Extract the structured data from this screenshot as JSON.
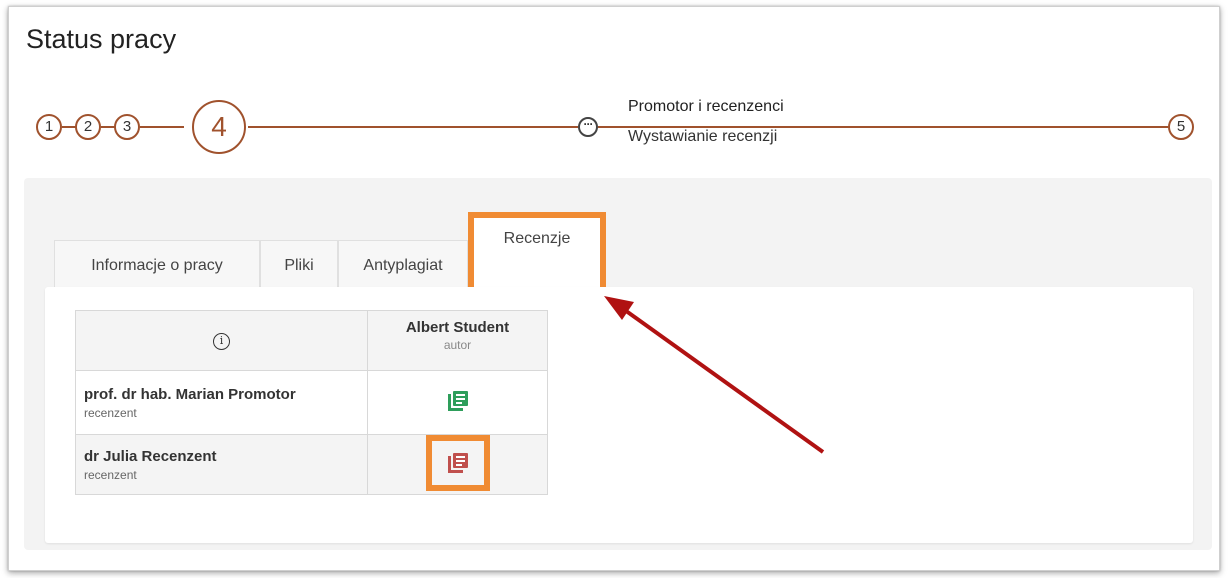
{
  "page": {
    "title": "Status pracy"
  },
  "stepper": {
    "steps": [
      "1",
      "2",
      "3",
      "4",
      "5"
    ],
    "current_step": "4",
    "current_caption": "Promotor i recenzenci",
    "current_subcaption": "Wystawianie recenzji"
  },
  "tabs": [
    {
      "label": "Informacje o pracy"
    },
    {
      "label": "Pliki"
    },
    {
      "label": "Antyplagiat"
    },
    {
      "label": "Recenzje",
      "active": true
    }
  ],
  "reviews_table": {
    "info_icon": "info-icon",
    "author": {
      "name": "Albert Student",
      "role": "autor"
    },
    "rows": [
      {
        "name": "prof. dr hab. Marian Promotor",
        "role": "recenzent",
        "icon": "review-document-icon",
        "icon_color": "#2e9e5b"
      },
      {
        "name": "dr Julia Recenzent",
        "role": "recenzent",
        "icon": "review-document-icon",
        "icon_color": "#c0504d"
      }
    ]
  },
  "colors": {
    "accent": "#a0522d",
    "highlight": "#f08b33",
    "annotation_arrow": "#b01212"
  }
}
